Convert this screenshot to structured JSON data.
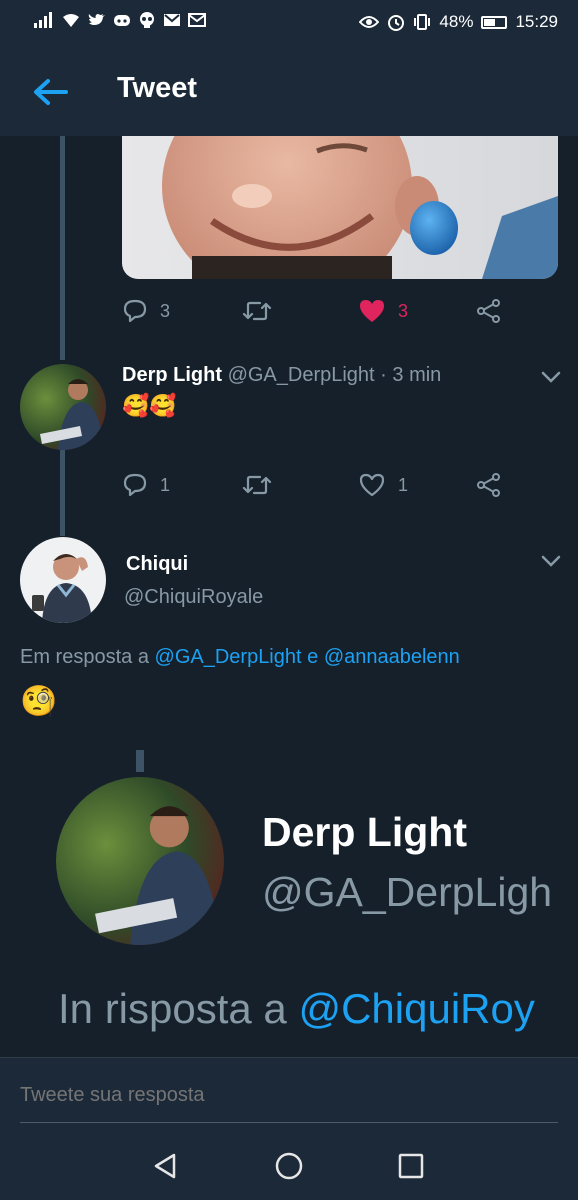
{
  "status_bar": {
    "battery": "48%",
    "time": "15:29"
  },
  "header": {
    "title": "Tweet",
    "back_icon": "back-arrow-icon"
  },
  "first_tweet_actions": {
    "replies": "3",
    "retweets": "",
    "likes": "3",
    "liked": true
  },
  "reply_tweet": {
    "name": "Derp Light",
    "handle": "@GA_DerpLight",
    "time": "· 3 min",
    "text": "🥰🥰",
    "replies": "1",
    "retweets": "",
    "likes": "1"
  },
  "main_tweet": {
    "name": "Chiqui",
    "handle": "@ChiquiRoyale",
    "reply_prefix": "Em resposta a",
    "reply_mention_1": "@GA_DerpLight",
    "reply_joiner": "e",
    "reply_mention_2": "@annaabelenn",
    "text": "🧐"
  },
  "embedded_card": {
    "name": "Derp Light",
    "handle": "@GA_DerpLigh",
    "reply_prefix": "In risposta a",
    "reply_mention": "@ChiquiRoy"
  },
  "compose": {
    "placeholder": "Tweete sua resposta"
  },
  "colors": {
    "background": "#15202b",
    "bar": "#1c2938",
    "accent": "#1da1f2",
    "like": "#e0245e",
    "muted": "#8899a6"
  }
}
